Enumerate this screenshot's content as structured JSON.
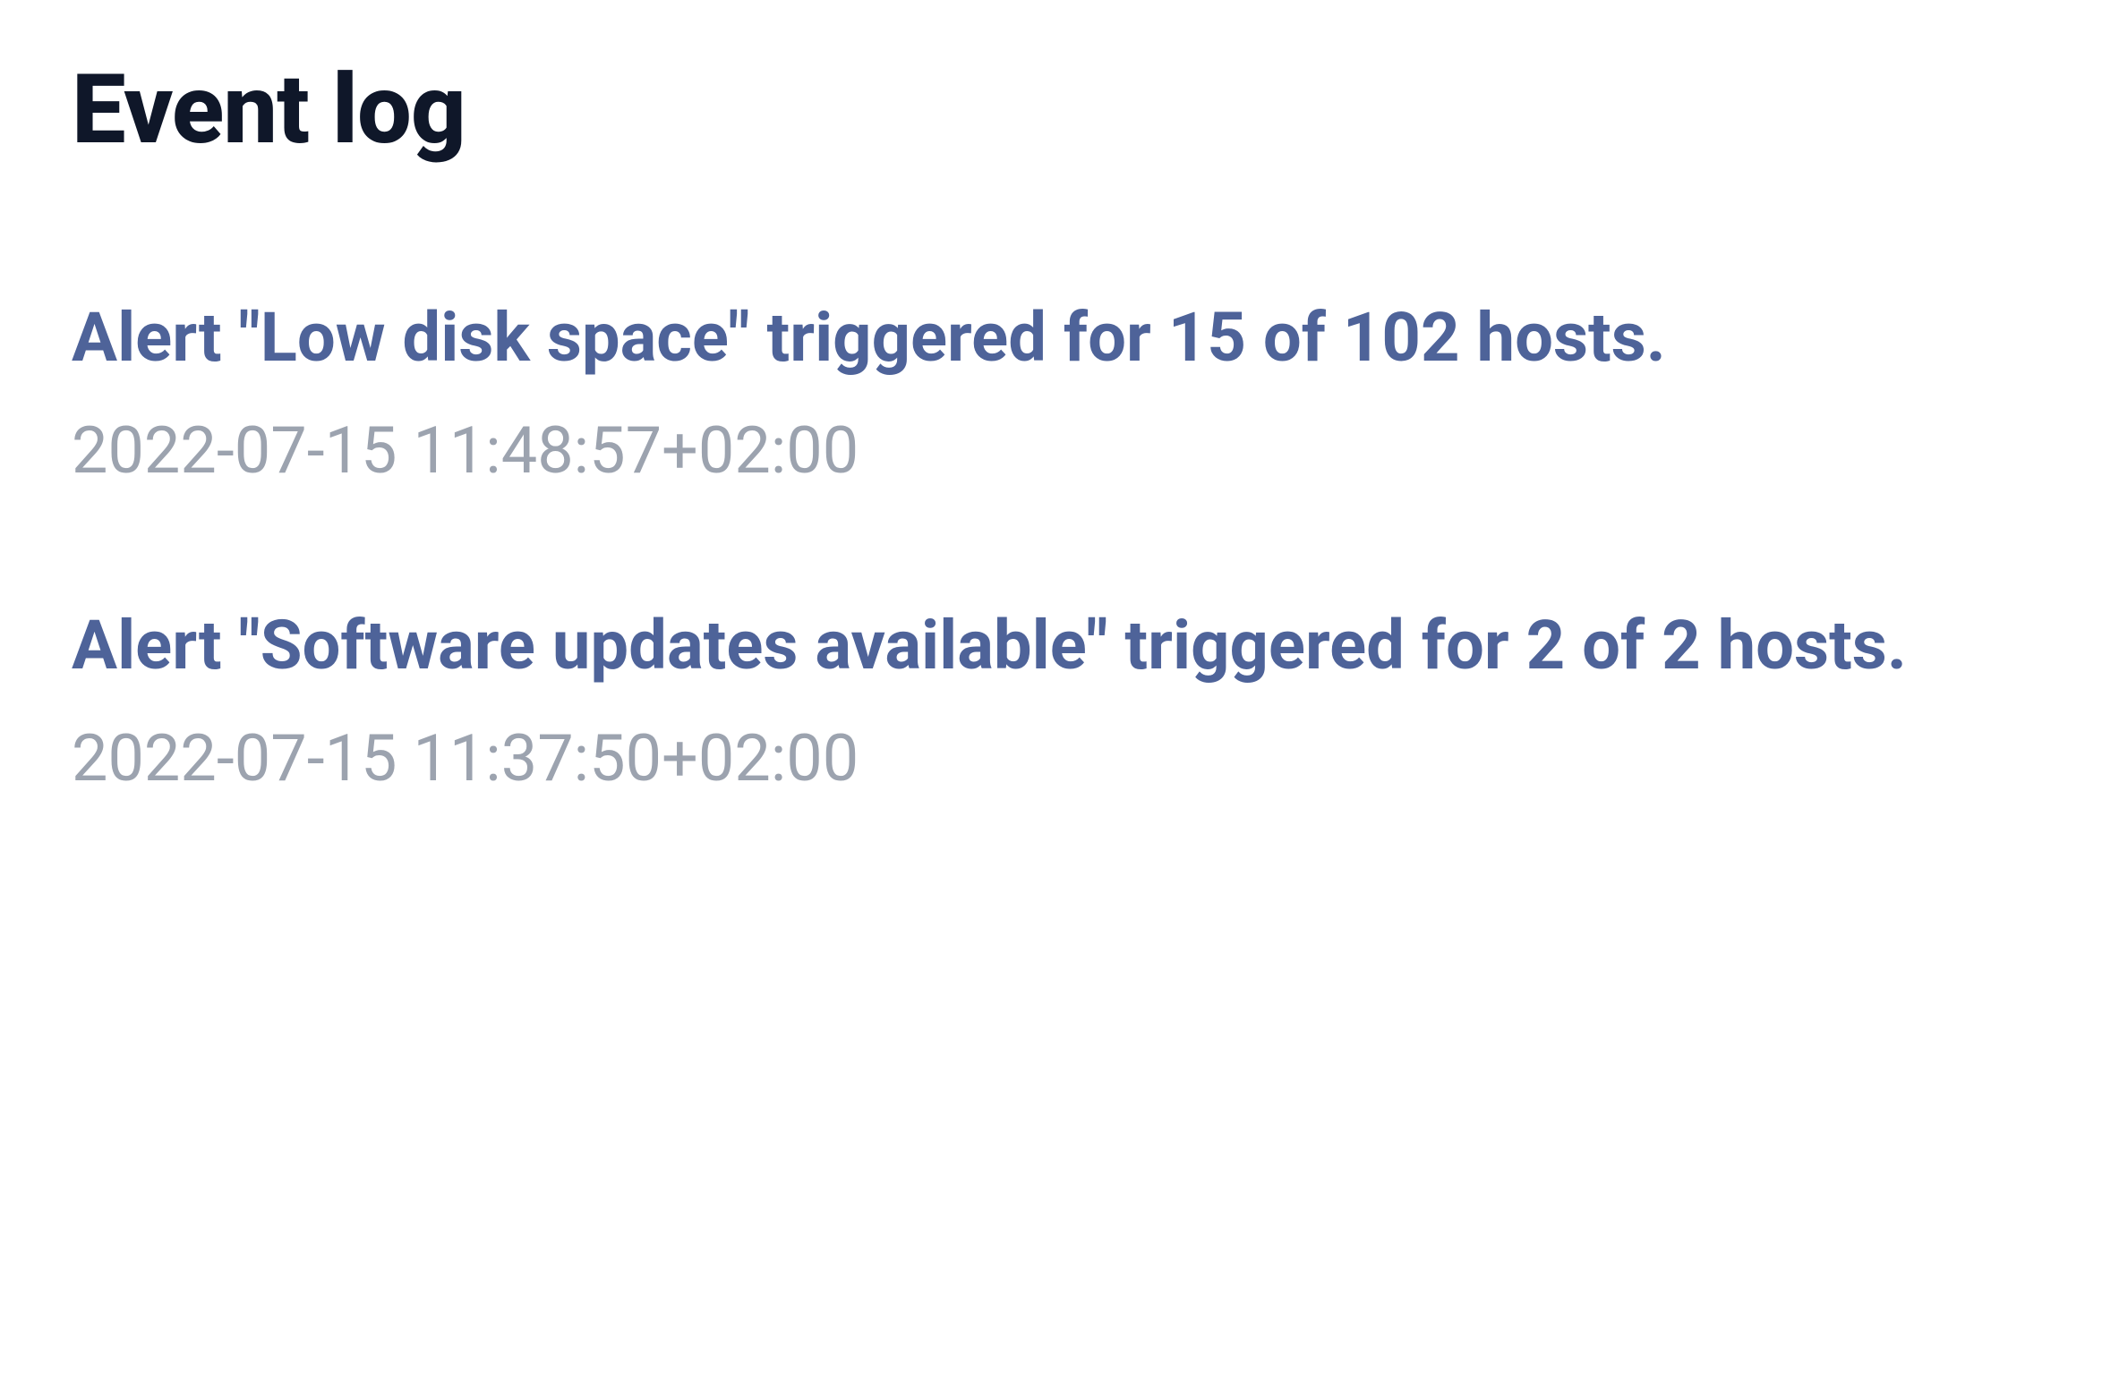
{
  "title": "Event log",
  "events": [
    {
      "title": "Alert \"Low disk space\" triggered for 15 of 102 hosts.",
      "timestamp": "2022-07-15 11:48:57+02:00"
    },
    {
      "title": "Alert \"Software updates available\" triggered for 2 of 2 hosts.",
      "timestamp": "2022-07-15 11:37:50+02:00"
    }
  ]
}
